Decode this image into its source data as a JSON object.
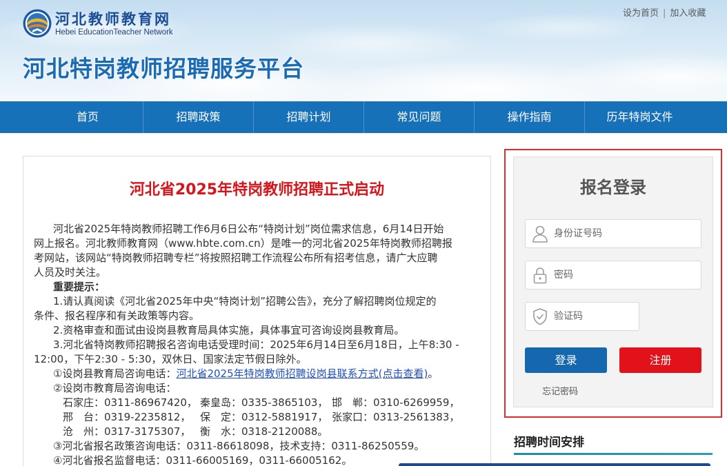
{
  "site": {
    "logo_name": "河北教师教育网",
    "logo_english": "Hebei EducationTeacher Network",
    "top_links": [
      "设为首页",
      "加入收藏"
    ],
    "top_link_separator": "|",
    "platform_title": "河北特岗教师招聘服务平台"
  },
  "nav": [
    "首页",
    "招聘政策",
    "招聘计划",
    "常见问题",
    "操作指南",
    "历年特岗文件"
  ],
  "article": {
    "title": "河北省2025年特岗教师招聘正式启动",
    "intro_lines": [
      "河北省2025年特岗教师招聘工作6月6日公布“特岗计划”岗位需求信息，6月14日开始",
      "网上报名。河北教师教育网（www.hbte.com.cn）是唯一的河北省2025年特岗教师招聘报",
      "考网站，该网站“特岗教师招聘专栏”将按照招聘工作流程公布所有招考信息，请广大应聘",
      "人员及时关注。"
    ],
    "notice_heading": "重要提示：",
    "notices": [
      [
        "1.请认真阅读《河北省2025年中央“特岗计划”招聘公告》，充分了解招聘岗位规定的",
        "条件、报名程序和有关政策等内容。"
      ],
      [
        "2.资格审查和面试由设岗县教育局具体实施，具体事宜可咨询设岗县教育局。"
      ],
      [
        "3.河北省特岗教师招聘报名咨询电话受理时间：2025年6月14日至6月18日，上午8:30 -",
        "12:00，下午2:30 - 5:30，双休日、国家法定节假日除外。"
      ]
    ],
    "county_contact": {
      "label": "①设岗县教育局咨询电话：",
      "link": "河北省2025年特岗教师招聘设岗县联系方式(点击查看)",
      "suffix": "。"
    },
    "city_contact": {
      "label": "②设岗市教育局咨询电话：",
      "rows": [
        [
          "石家庄：0311-86967420，",
          "秦皇岛：0335-3865103，",
          "邯　郸：0310-6269959，"
        ],
        [
          "邢　台：0319-2235812，",
          "保　定：0312-5881917，",
          "张家口：0313-2561383，"
        ],
        [
          "沧　州：0317-3175307，",
          "衡　水：0318-2120088。"
        ]
      ]
    },
    "policy_contact": "③河北省报名政策咨询电话：0311-86618098，技术支持：0311-86250559。",
    "supervision_contact": "④河北省报名监督电话：0311-66005169，0311-66005162。"
  },
  "login": {
    "title": "报名登录",
    "id_number": {
      "value": "",
      "placeholder": "身份证号码",
      "icon": "user-icon"
    },
    "password": {
      "value": "",
      "placeholder": "密码",
      "icon": "lock-icon"
    },
    "captcha": {
      "value": "",
      "placeholder": "验证码",
      "icon": "shield-check-icon"
    },
    "login_label": "登录",
    "register_label": "注册",
    "forgot_password_label": "忘记密码"
  },
  "schedule": {
    "title": "招聘时间安排"
  },
  "icons": {
    "logo": "hbte-emblem-icon"
  },
  "colors": {
    "nav_bg": "#1771b8",
    "platform_title": "#1a6ab4",
    "article_title": "#d7141a",
    "link": "#2050c8",
    "login_frame": "#e02b2b",
    "login_button": "#1567ae",
    "register_button": "#e2121b",
    "schedule_rule": "#2f9db4"
  }
}
